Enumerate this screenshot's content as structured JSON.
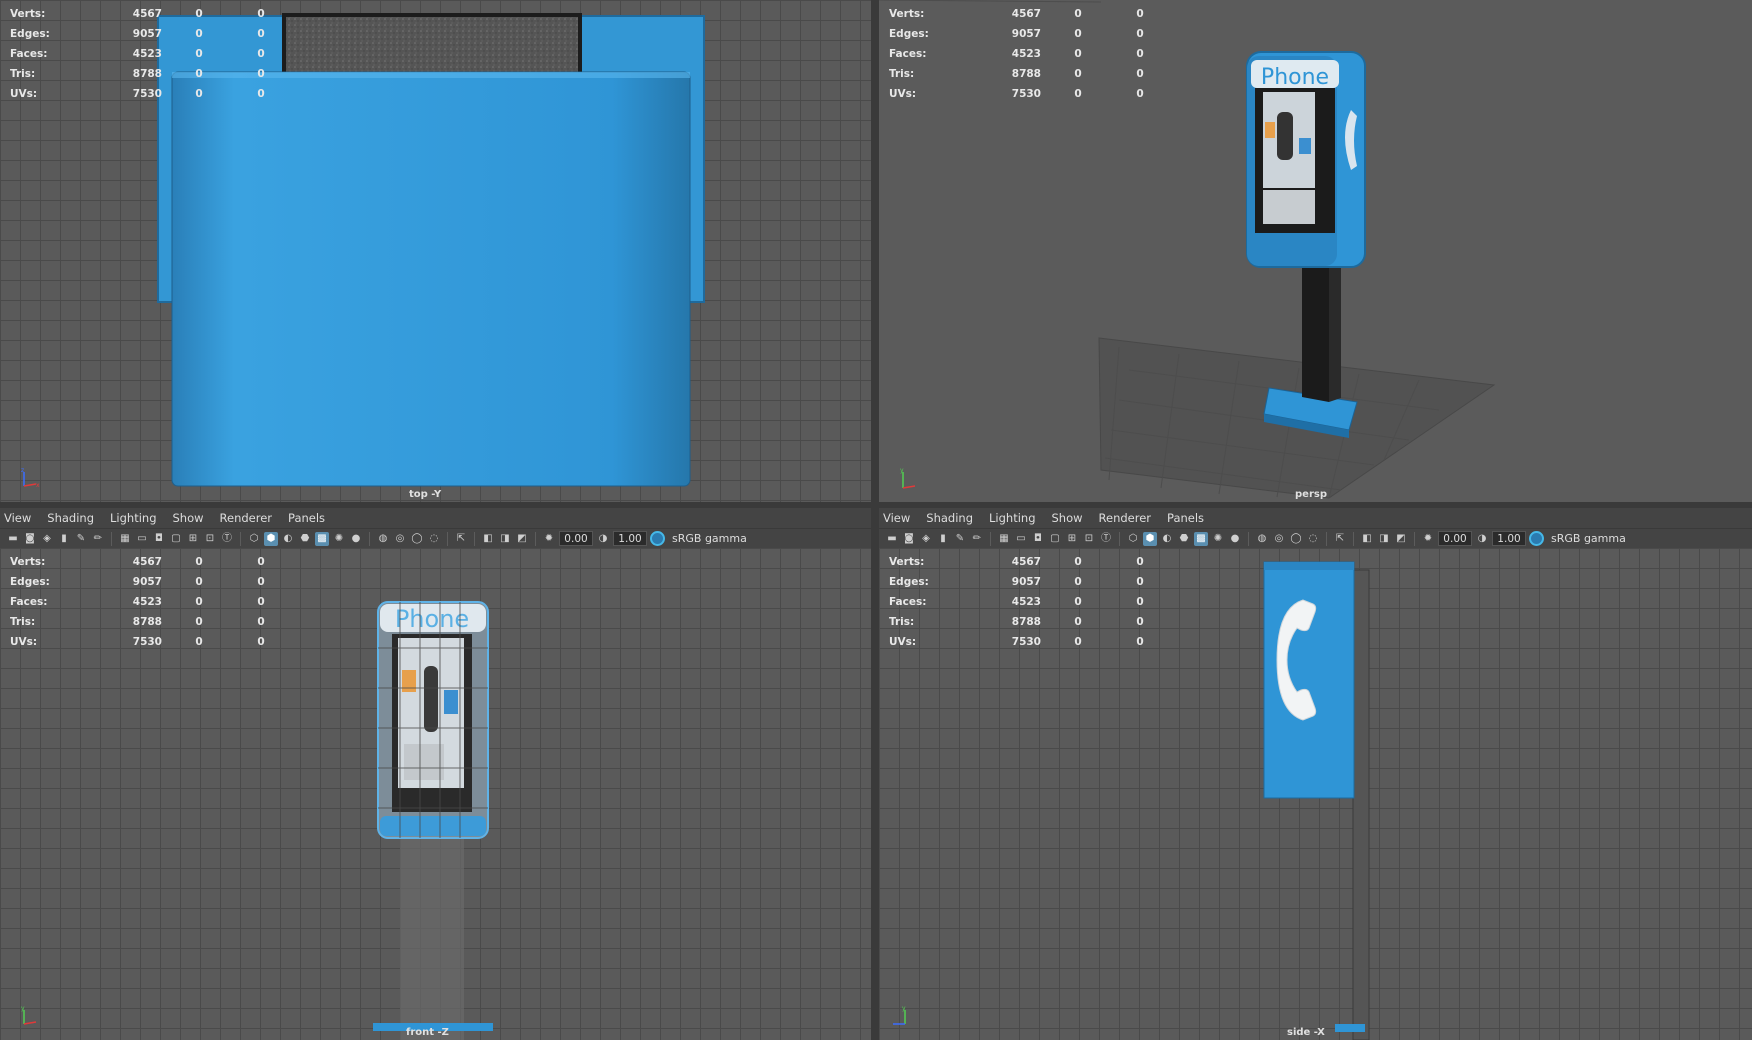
{
  "stats": {
    "rows": [
      {
        "label": "Verts:",
        "v1": "4567",
        "v2": "0",
        "v3": "0"
      },
      {
        "label": "Edges:",
        "v1": "9057",
        "v2": "0",
        "v3": "0"
      },
      {
        "label": "Faces:",
        "v1": "4523",
        "v2": "0",
        "v3": "0"
      },
      {
        "label": "Tris:",
        "v1": "8788",
        "v2": "0",
        "v3": "0"
      },
      {
        "label": "UVs:",
        "v1": "7530",
        "v2": "0",
        "v3": "0"
      }
    ]
  },
  "menu": {
    "view": "View",
    "shading": "Shading",
    "lighting": "Lighting",
    "show": "Show",
    "renderer": "Renderer",
    "panels": "Panels"
  },
  "toolbar": {
    "exposure": "0.00",
    "gamma": "1.00",
    "color_space": "sRGB gamma"
  },
  "cameras": {
    "top": "top -Y",
    "persp": "persp",
    "front": "front -Z",
    "side": "side -X"
  },
  "booth": {
    "sign_text": "Phone"
  },
  "colors": {
    "booth_blue": "#2f95d6",
    "viewport_bg": "#5a5a5a",
    "panel_bg": "#444444",
    "accent": "#45b8e8"
  }
}
